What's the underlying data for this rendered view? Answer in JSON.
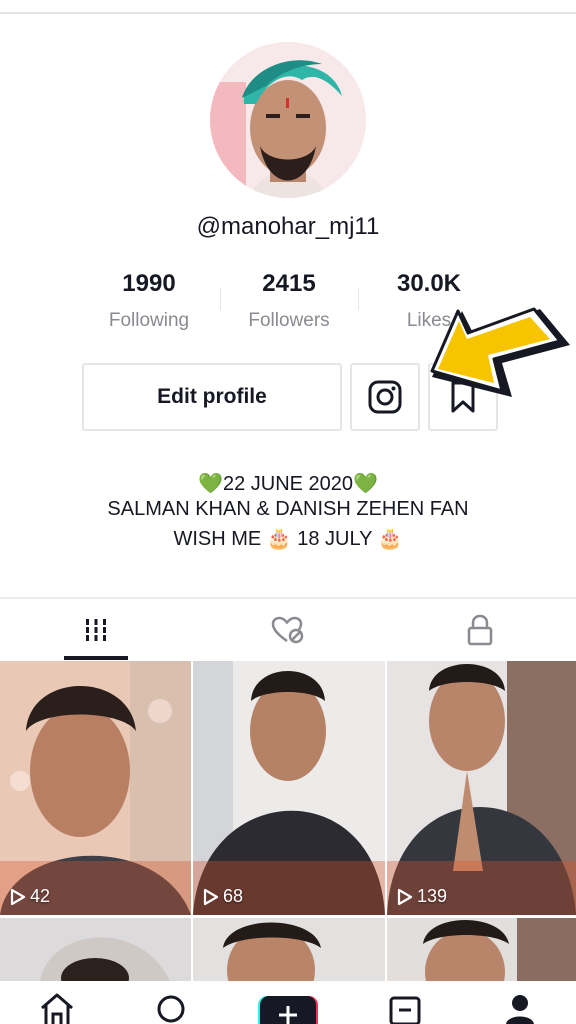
{
  "profile": {
    "username": "@manohar_mj11",
    "stats": [
      {
        "value": "1990",
        "label": "Following"
      },
      {
        "value": "2415",
        "label": "Followers"
      },
      {
        "value": "30.0K",
        "label": "Likes"
      }
    ],
    "edit_label": "Edit profile",
    "bio": [
      "💚22 JUNE 2020💚",
      "SALMAN KHAN & DANISH ZEHEN FAN",
      "WISH ME 🎂 18 JULY 🎂"
    ]
  },
  "tabs": [
    {
      "icon": "grid-icon",
      "active": true
    },
    {
      "icon": "liked-hidden-icon",
      "active": false
    },
    {
      "icon": "lock-icon",
      "active": false
    }
  ],
  "videos": [
    {
      "views": "42"
    },
    {
      "views": "68"
    },
    {
      "views": "139"
    }
  ],
  "nav": [
    {
      "icon": "home-icon"
    },
    {
      "icon": "discover-icon"
    },
    {
      "icon": "create-icon"
    },
    {
      "icon": "inbox-icon"
    },
    {
      "icon": "profile-icon"
    }
  ],
  "colors": {
    "annotation_arrow": "#f7c400",
    "text": "#161823",
    "muted": "#8a8b91"
  }
}
